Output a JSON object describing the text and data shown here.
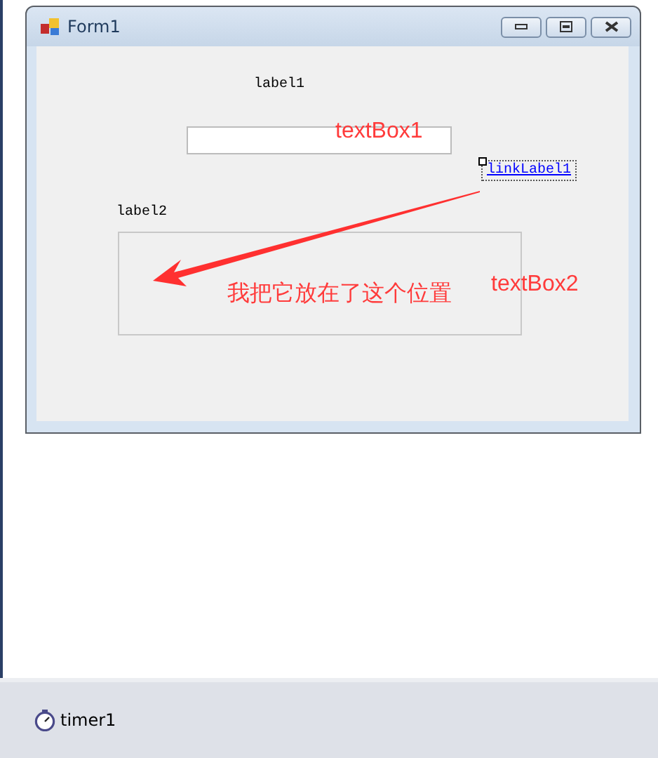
{
  "window": {
    "title": "Form1",
    "controls": [
      {
        "kind": "label",
        "text": "label1"
      },
      {
        "kind": "textbox"
      },
      {
        "kind": "link",
        "text": "linkLabel1",
        "selected": true
      },
      {
        "kind": "label",
        "text": "label2"
      },
      {
        "kind": "textbox"
      }
    ]
  },
  "annotations": [
    {
      "kind": "text",
      "text": "textBox1"
    },
    {
      "kind": "arrow"
    },
    {
      "kind": "text",
      "text": "我把它放在了这个位置"
    },
    {
      "kind": "text",
      "text": "textBox2"
    }
  ],
  "component_tray": {
    "items": [
      {
        "text": "timer1"
      }
    ]
  }
}
